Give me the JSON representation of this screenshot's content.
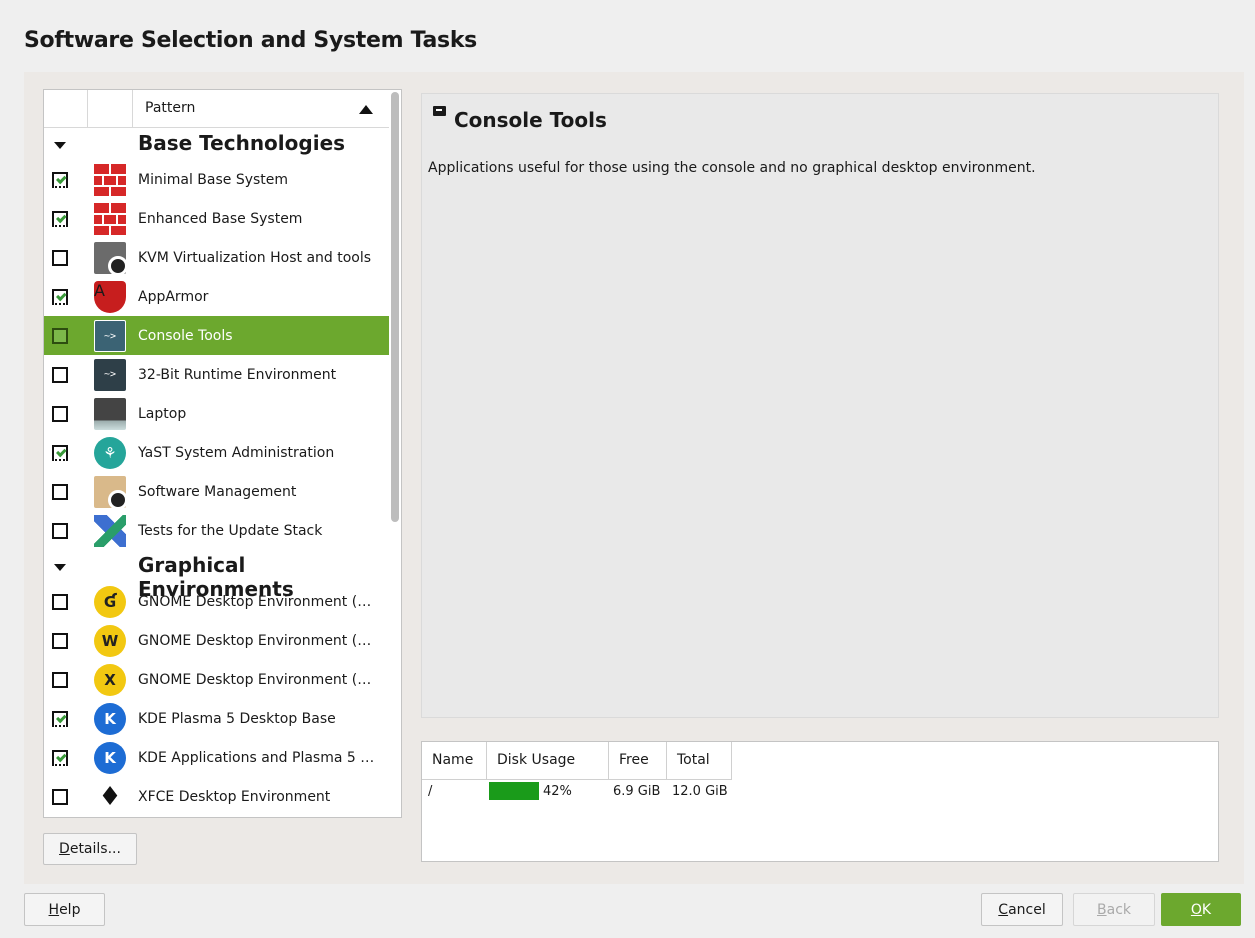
{
  "title": "Software Selection and System Tasks",
  "list": {
    "header_pattern": "Pattern",
    "groups": [
      {
        "name": "Base Technologies",
        "items": [
          {
            "label": "Minimal Base System",
            "checked": true,
            "icon": "brick-wall-icon"
          },
          {
            "label": "Enhanced Base System",
            "checked": true,
            "icon": "brick-wall-icon"
          },
          {
            "label": "KVM Virtualization Host and tools",
            "checked": false,
            "icon": "server-gear-icon"
          },
          {
            "label": "AppArmor",
            "checked": true,
            "icon": "apparmor-shield-icon"
          },
          {
            "label": "Console Tools",
            "checked": false,
            "icon": "terminal-icon",
            "selected": true
          },
          {
            "label": "32-Bit Runtime Environment",
            "checked": false,
            "icon": "terminal-icon"
          },
          {
            "label": "Laptop",
            "checked": false,
            "icon": "laptop-icon"
          },
          {
            "label": "YaST System Administration",
            "checked": true,
            "icon": "yast-icon"
          },
          {
            "label": "Software Management",
            "checked": false,
            "icon": "package-gear-icon"
          },
          {
            "label": "Tests for the Update Stack",
            "checked": false,
            "icon": "flask-icon"
          }
        ]
      },
      {
        "name": "Graphical Environments",
        "items": [
          {
            "label": "GNOME Desktop Environment (…",
            "checked": false,
            "icon": "gnome-icon"
          },
          {
            "label": "GNOME Desktop Environment (…",
            "checked": false,
            "icon": "gnome-wayland-icon"
          },
          {
            "label": "GNOME Desktop Environment (…",
            "checked": false,
            "icon": "gnome-x11-icon"
          },
          {
            "label": "KDE Plasma 5 Desktop Base",
            "checked": true,
            "icon": "kde-icon"
          },
          {
            "label": "KDE Applications and Plasma 5 …",
            "checked": true,
            "icon": "kde-icon"
          },
          {
            "label": "XFCE Desktop Environment",
            "checked": false,
            "icon": "xfce-icon"
          }
        ]
      }
    ]
  },
  "details_button": "Details...",
  "description": {
    "title": "Console Tools",
    "text": "Applications useful for those using the console and no graphical desktop environment."
  },
  "disk": {
    "headers": [
      "Name",
      "Disk Usage",
      "Free",
      "Total"
    ],
    "rows": [
      {
        "name": "/",
        "usage_percent": 42,
        "usage_label": "42%",
        "free": "6.9 GiB",
        "total": "12.0 GiB"
      }
    ]
  },
  "buttons": {
    "help": "Help",
    "cancel": "Cancel",
    "back": "Back",
    "ok": "OK"
  },
  "colors": {
    "accent": "#6ca82e",
    "usage_bar": "#1a9b1a"
  }
}
